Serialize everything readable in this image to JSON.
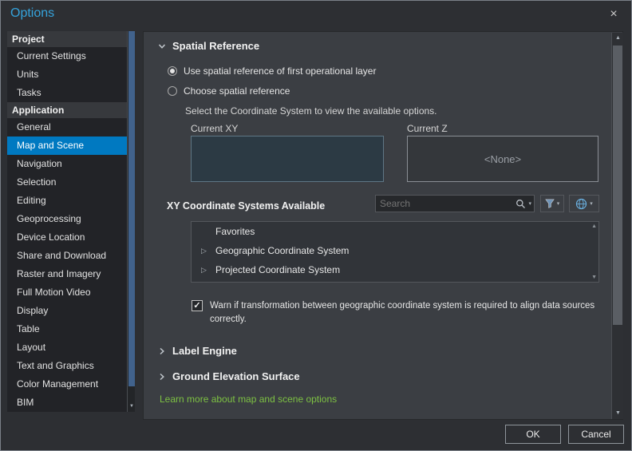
{
  "window": {
    "title": "Options"
  },
  "icons": {
    "close": "×",
    "dropdown_arrow": "▾",
    "expander_right": "▷",
    "scroll_up": "▲",
    "scroll_down": "▼",
    "check": "✓"
  },
  "sidebar": {
    "sections": [
      {
        "header": "Project",
        "items": [
          {
            "label": "Current Settings"
          },
          {
            "label": "Units"
          },
          {
            "label": "Tasks"
          }
        ]
      },
      {
        "header": "Application",
        "items": [
          {
            "label": "General"
          },
          {
            "label": "Map and Scene"
          },
          {
            "label": "Navigation"
          },
          {
            "label": "Selection"
          },
          {
            "label": "Editing"
          },
          {
            "label": "Geoprocessing"
          },
          {
            "label": "Device Location"
          },
          {
            "label": "Share and Download"
          },
          {
            "label": "Raster and Imagery"
          },
          {
            "label": "Full Motion Video"
          },
          {
            "label": "Display"
          },
          {
            "label": "Table"
          },
          {
            "label": "Layout"
          },
          {
            "label": "Text and Graphics"
          },
          {
            "label": "Color Management"
          },
          {
            "label": "BIM"
          }
        ]
      }
    ],
    "selected": "Map and Scene"
  },
  "content": {
    "spatial_reference": {
      "title": "Spatial Reference",
      "radio_first_layer": "Use spatial reference of first operational layer",
      "radio_choose": "Choose spatial reference",
      "hint": "Select the Coordinate System to view the available options.",
      "current_xy_label": "Current XY",
      "current_z_label": "Current Z",
      "current_z_value": "<None>",
      "available_label": "XY Coordinate Systems Available",
      "search_placeholder": "Search",
      "list": [
        {
          "label": "Favorites"
        },
        {
          "label": "Geographic Coordinate System"
        },
        {
          "label": "Projected Coordinate System"
        }
      ],
      "warn_text": "Warn if transformation between geographic coordinate system is required to align data sources correctly."
    },
    "collapsed_sections": [
      {
        "title": "Label Engine"
      },
      {
        "title": "Ground Elevation Surface"
      }
    ],
    "learn_more": "Learn more about map and scene options"
  },
  "footer": {
    "ok": "OK",
    "cancel": "Cancel"
  },
  "colors": {
    "accent": "#0079c1",
    "title_blue": "#35a3dc",
    "link_green": "#7dc143"
  }
}
